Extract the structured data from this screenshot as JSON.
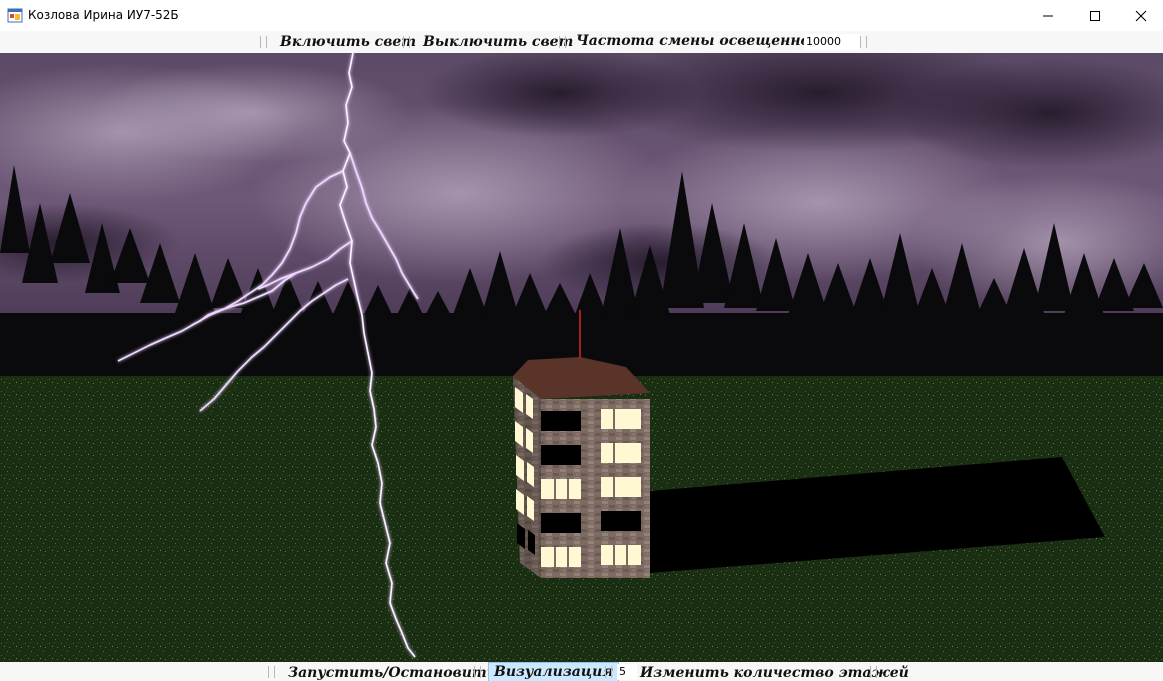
{
  "window": {
    "title": "Козлова Ирина ИУ7-52Б",
    "icon": "winforms-app-icon",
    "controls": [
      "minimize-icon",
      "maximize-icon",
      "close-icon"
    ]
  },
  "top_toolbar": {
    "light_on_label": "Включить свет",
    "light_off_label": "Выключить свет",
    "frequency_label": "Частота смены освещенности",
    "frequency_value": "10000"
  },
  "bottom_toolbar": {
    "start_stop_label": "Запустить/Остановить",
    "visualization_label": "Визуализация",
    "floors_value": "5",
    "change_floors_label": "Изменить количество этажей"
  },
  "scene": {
    "sky_color": "#6a5674",
    "ground_color": "#1f3a18",
    "lightning_color": "#e8c8ff",
    "building_floors": 5,
    "roof_color": "#5a3428",
    "lit_window_color": "#fff8d2"
  }
}
